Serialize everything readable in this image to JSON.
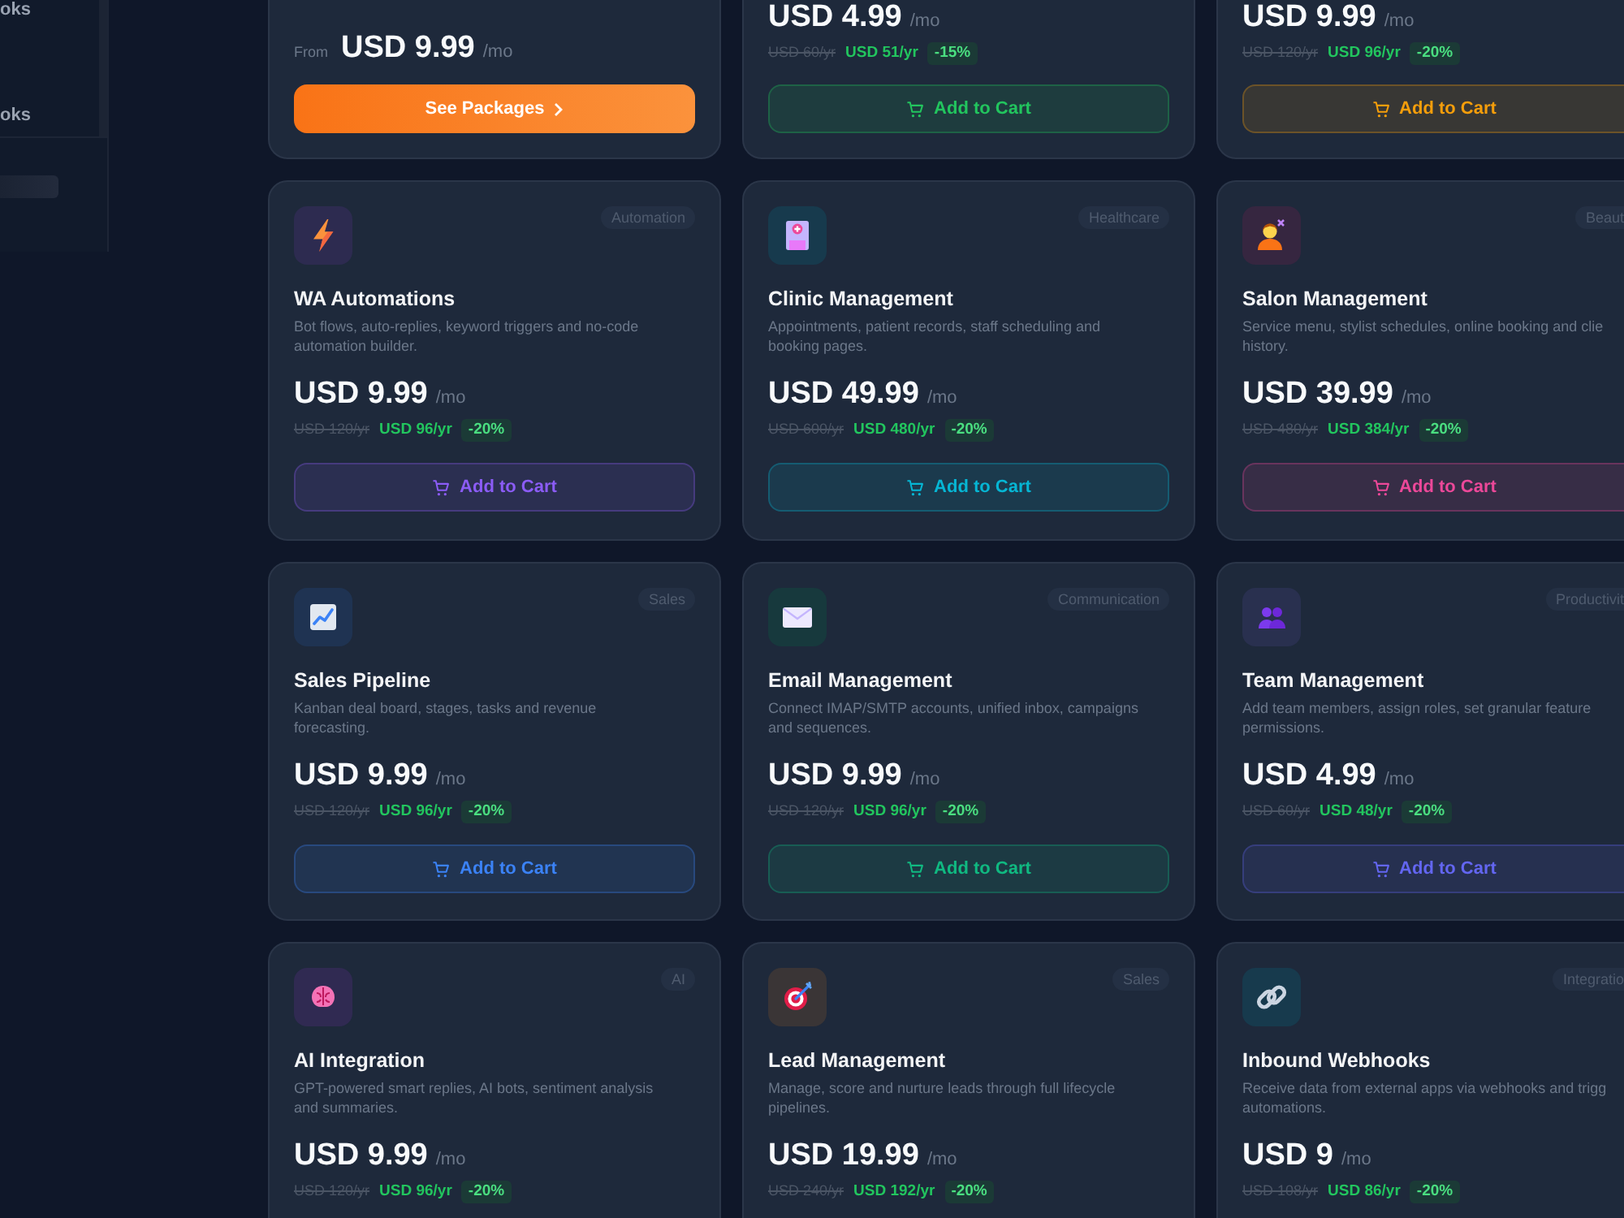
{
  "sidebar": {
    "items": [
      {
        "label": "oks"
      },
      {
        "label": "oks"
      }
    ]
  },
  "packages_card": {
    "from_label": "From",
    "price": "USD 9.99",
    "period": "/mo",
    "button": "See Packages"
  },
  "cards": [
    {
      "price": "USD 4.99",
      "period": "/mo",
      "old_price": "USD 60/yr",
      "yearly_price": "USD 51/yr",
      "discount": "-15%",
      "button": "Add to Cart",
      "color": "#22c55e"
    },
    {
      "price": "USD 9.99",
      "period": "/mo",
      "old_price": "USD 120/yr",
      "yearly_price": "USD 96/yr",
      "discount": "-20%",
      "button": "Add to Cart",
      "color": "#f59e0b"
    },
    {
      "category": "Automation",
      "title": "WA Automations",
      "description": "Bot flows, auto-replies, keyword triggers and no-code automation builder.",
      "price": "USD 9.99",
      "period": "/mo",
      "old_price": "USD 120/yr",
      "yearly_price": "USD 96/yr",
      "discount": "-20%",
      "button": "Add to Cart",
      "color": "#8b5cf6"
    },
    {
      "category": "Healthcare",
      "title": "Clinic Management",
      "description": "Appointments, patient records, staff scheduling and booking pages.",
      "price": "USD 49.99",
      "period": "/mo",
      "old_price": "USD 600/yr",
      "yearly_price": "USD 480/yr",
      "discount": "-20%",
      "button": "Add to Cart",
      "color": "#06b6d4"
    },
    {
      "category": "Beaut",
      "title": "Salon Management",
      "description": "Service menu, stylist schedules, online booking and clie\nhistory.",
      "price": "USD 39.99",
      "period": "/mo",
      "old_price": "USD 480/yr",
      "yearly_price": "USD 384/yr",
      "discount": "-20%",
      "button": "Add to Cart",
      "color": "#ec4899"
    },
    {
      "category": "Sales",
      "title": "Sales Pipeline",
      "description": "Kanban deal board, stages, tasks and revenue forecasting.",
      "price": "USD 9.99",
      "period": "/mo",
      "old_price": "USD 120/yr",
      "yearly_price": "USD 96/yr",
      "discount": "-20%",
      "button": "Add to Cart",
      "color": "#3b82f6"
    },
    {
      "category": "Communication",
      "title": "Email Management",
      "description": "Connect IMAP/SMTP accounts, unified inbox, campaigns and sequences.",
      "price": "USD 9.99",
      "period": "/mo",
      "old_price": "USD 120/yr",
      "yearly_price": "USD 96/yr",
      "discount": "-20%",
      "button": "Add to Cart",
      "color": "#10b981"
    },
    {
      "category": "Productivit",
      "title": "Team Management",
      "description": "Add team members, assign roles, set granular feature permissions.",
      "price": "USD 4.99",
      "period": "/mo",
      "old_price": "USD 60/yr",
      "yearly_price": "USD 48/yr",
      "discount": "-20%",
      "button": "Add to Cart",
      "color": "#6366f1"
    },
    {
      "category": "AI",
      "title": "AI Integration",
      "description": "GPT-powered smart replies, AI bots, sentiment analysis and summaries.",
      "price": "USD 9.99",
      "period": "/mo",
      "old_price": "USD 120/yr",
      "yearly_price": "USD 96/yr",
      "discount": "-20%"
    },
    {
      "category": "Sales",
      "title": "Lead Management",
      "description": "Manage, score and nurture leads through full lifecycle pipelines.",
      "price": "USD 19.99",
      "period": "/mo",
      "old_price": "USD 240/yr",
      "yearly_price": "USD 192/yr",
      "discount": "-20%"
    },
    {
      "category": "Integratio",
      "title": "Inbound Webhooks",
      "description": "Receive data from external apps via webhooks and trigg\nautomations.",
      "price": "USD 9",
      "period": "/mo",
      "old_price": "USD 108/yr",
      "yearly_price": "USD 86/yr",
      "discount": "-20%"
    }
  ]
}
